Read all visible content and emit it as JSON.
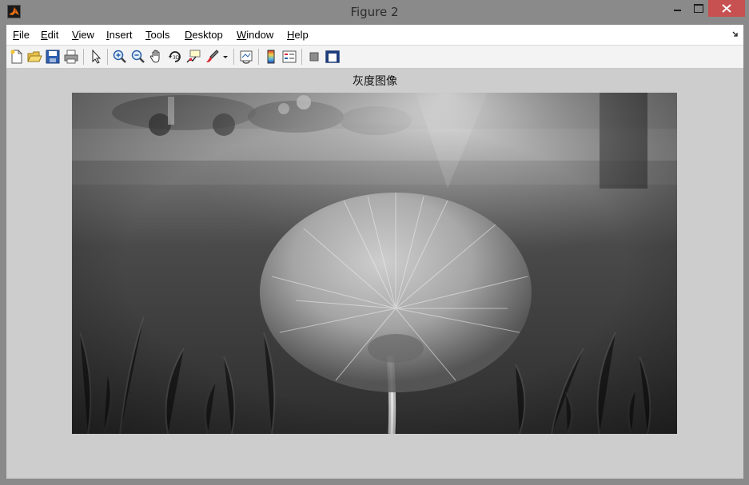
{
  "window": {
    "title": "Figure 2"
  },
  "menu": {
    "items": [
      {
        "accel": "F",
        "rest": "ile"
      },
      {
        "accel": "E",
        "rest": "dit"
      },
      {
        "accel": "V",
        "rest": "iew"
      },
      {
        "accel": "I",
        "rest": "nsert"
      },
      {
        "accel": "T",
        "rest": "ools"
      },
      {
        "accel": "D",
        "rest": "esktop"
      },
      {
        "accel": "W",
        "rest": "indow"
      },
      {
        "accel": "H",
        "rest": "elp"
      }
    ]
  },
  "toolbar": {
    "icons": [
      "new-figure-icon",
      "open-file-icon",
      "save-icon",
      "print-icon",
      "edit-plot-arrow-icon",
      "zoom-in-icon",
      "zoom-out-icon",
      "pan-hand-icon",
      "rotate-3d-icon",
      "data-cursor-icon",
      "brush-icon",
      "link-plot-icon",
      "colorbar-icon",
      "legend-icon",
      "hide-plot-tools-icon",
      "show-plot-tools-icon"
    ]
  },
  "axes": {
    "title": "灰度图像"
  },
  "colors": {
    "frame": "#8a8a8a",
    "close_button": "#c75050",
    "figure_background": "#cdcdcd"
  }
}
